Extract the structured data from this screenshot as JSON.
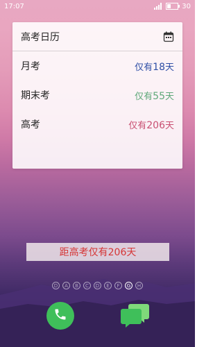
{
  "status_bar": {
    "time": "17:07",
    "battery": "30"
  },
  "widget": {
    "title": "高考日历",
    "rows": [
      {
        "name": "月考",
        "prefix": "仅有",
        "days": "18",
        "suffix": "天",
        "color": "#2f4fa6"
      },
      {
        "name": "期末考",
        "prefix": "仅有",
        "days": "55",
        "suffix": "天",
        "color": "#5fa879"
      },
      {
        "name": "高考",
        "prefix": "仅有",
        "days": "206",
        "suffix": "天",
        "color": "#c94f72"
      }
    ]
  },
  "banner": {
    "text": "距高考仅有206天"
  },
  "page_indicators": [
    "D",
    "A",
    "B",
    "C",
    "D",
    "E",
    "F",
    "G",
    "H"
  ],
  "active_page": "G",
  "dock": {
    "phone_icon": "phone-icon",
    "messages_icon": "messages-icon"
  }
}
